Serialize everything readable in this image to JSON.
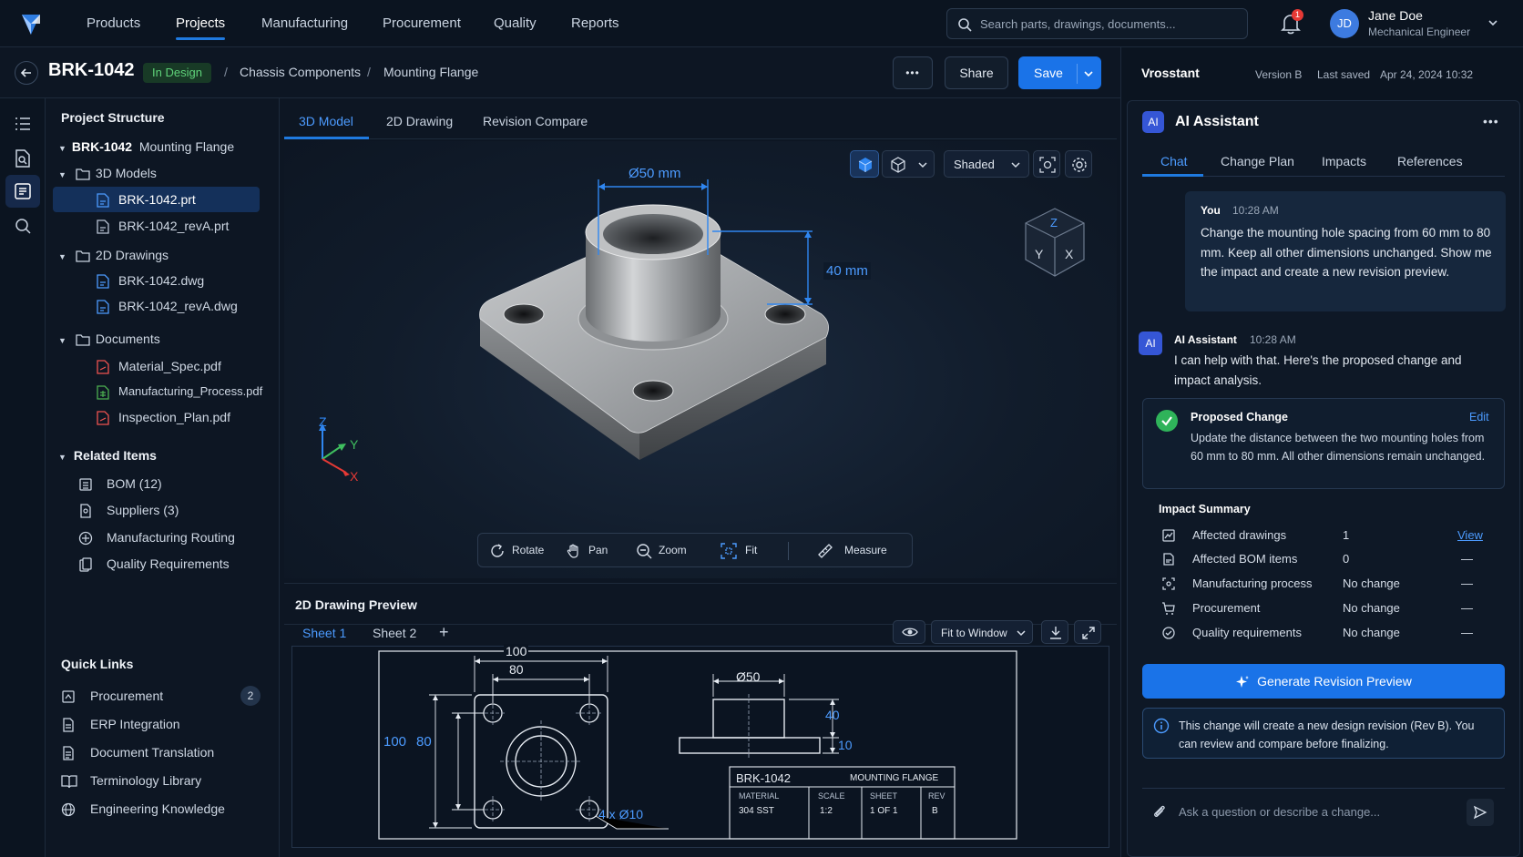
{
  "nav": {
    "items": [
      "Products",
      "Projects",
      "Manufacturing",
      "Procurement",
      "Quality",
      "Reports"
    ],
    "active_index": 1,
    "search_placeholder": "Search parts, drawings, documents...",
    "notifications_count": "1",
    "user": {
      "initials": "JD",
      "name": "Jane Doe",
      "role": "Mechanical Engineer"
    }
  },
  "header": {
    "part_id": "BRK-1042",
    "status": "In Design",
    "breadcrumb": [
      "Chassis Components",
      "Mounting Flange"
    ],
    "more_label": "•••",
    "share_label": "Share",
    "save_label": "Save",
    "brand": "Vrosstant",
    "version": "Version B",
    "last_saved_label": "Last saved",
    "last_saved": "Apr 24, 2024 10:32"
  },
  "sidebar": {
    "title": "Project Structure",
    "root": {
      "id": "BRK-1042",
      "name": "Mounting Flange"
    },
    "folders": [
      {
        "name": "3D Models",
        "files": [
          "BRK-1042.prt",
          "BRK-1042_revA.prt"
        ]
      },
      {
        "name": "2D Drawings",
        "files": [
          "BRK-1042.dwg",
          "BRK-1042_revA.dwg"
        ]
      },
      {
        "name": "Documents",
        "files": [
          "Material_Spec.pdf",
          "Manufacturing_Process.pdf",
          "Inspection_Plan.pdf"
        ]
      }
    ],
    "related_title": "Related Items",
    "related": [
      "BOM (12)",
      "Suppliers (3)",
      "Manufacturing Routing",
      "Quality Requirements"
    ],
    "quick_title": "Quick Links",
    "quick": [
      "Procurement",
      "ERP Integration",
      "Document Translation",
      "Terminology Library",
      "Engineering Knowledge"
    ],
    "procurement_badge": "2"
  },
  "main": {
    "tabs": [
      "3D Model",
      "2D Drawing",
      "Revision Compare"
    ],
    "active_tab": 0,
    "view_mode": "Shaded",
    "dim_diameter": "Ø50 mm",
    "dim_height": "40 mm",
    "axis": {
      "x": "X",
      "y": "Y",
      "z": "Z"
    },
    "tools": [
      "Rotate",
      "Pan",
      "Zoom",
      "Fit",
      "Measure"
    ],
    "drawing_title": "2D Drawing Preview",
    "sheets": [
      "Sheet 1",
      "Sheet 2"
    ],
    "fit_label": "Fit to Window",
    "drawing": {
      "dims": {
        "w100": "100",
        "w80": "80",
        "h100": "100",
        "h80": "80",
        "holes": "4 x Ø10",
        "d50": "Ø50",
        "h40": "40",
        "h10": "10"
      },
      "titleblock": {
        "part": "BRK-1042",
        "name": "MOUNTING FLANGE",
        "material_label": "MATERIAL",
        "material": "304 SST",
        "scale_label": "SCALE",
        "scale": "1:2",
        "sheet_label": "SHEET",
        "sheet": "1 OF 1",
        "rev_label": "REV",
        "rev": "B"
      }
    }
  },
  "ai": {
    "title": "AI Assistant",
    "tabs": [
      "Chat",
      "Change Plan",
      "Impacts",
      "References"
    ],
    "active_tab": 0,
    "user_msg": {
      "who": "You",
      "time": "10:28 AM",
      "text": "Change the mounting hole spacing from 60 mm to 80 mm. Keep all other dimensions unchanged. Show me the impact and create a new revision preview."
    },
    "bot_msg": {
      "who": "AI Assistant",
      "time": "10:28 AM",
      "text": "I can help with that. Here's the proposed change and impact analysis."
    },
    "proposed": {
      "title": "Proposed Change",
      "edit": "Edit",
      "text": "Update the distance between the two mounting holes from 60 mm to 80 mm. All other dimensions remain unchanged."
    },
    "impact_title": "Impact Summary",
    "impacts": [
      {
        "label": "Affected drawings",
        "value": "1",
        "action": "View"
      },
      {
        "label": "Affected BOM items",
        "value": "0",
        "action": "—"
      },
      {
        "label": "Manufacturing process",
        "value": "No change",
        "action": "—"
      },
      {
        "label": "Procurement",
        "value": "No change",
        "action": "—"
      },
      {
        "label": "Quality requirements",
        "value": "No change",
        "action": "—"
      }
    ],
    "generate_label": "Generate Revision Preview",
    "info_text": "This change will create a new design revision (Rev B). You can review and compare before finalizing.",
    "ask_placeholder": "Ask a question or describe a change...",
    "ai_badge": "AI"
  }
}
